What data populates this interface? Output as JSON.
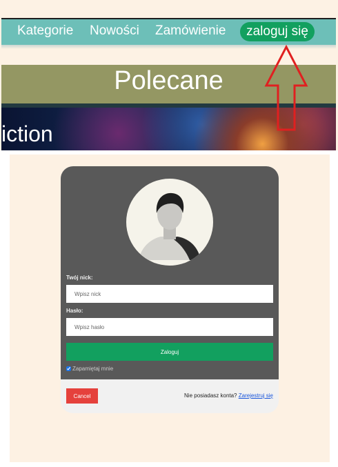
{
  "nav": {
    "items": [
      {
        "label": "Kategorie"
      },
      {
        "label": "Nowości"
      },
      {
        "label": "Zamówienie"
      }
    ],
    "login_label": "zaloguj się"
  },
  "featured": {
    "title": "Polecane"
  },
  "banner": {
    "title": "iction"
  },
  "login_form": {
    "nick_label": "Twój nick:",
    "nick_placeholder": "Wpisz nick",
    "password_label": "Hasło:",
    "password_placeholder": "Wpisz hasło",
    "submit_label": "Zaloguj",
    "remember_label": "Zapamiętaj mnie",
    "remember_checked": true
  },
  "footer": {
    "cancel_label": "Cancel",
    "no_account_text": "Nie posiadasz konta?",
    "register_link": "Zarejestruj się"
  },
  "colors": {
    "nav_bg": "#6dbfb8",
    "login_pill": "#12a05f",
    "featured_bar": "#949763",
    "modal_dark": "#595959",
    "submit_button": "#12a05f",
    "cancel_button": "#e5413c",
    "page_bg": "#fdf1e3",
    "arrow": "#e02020"
  },
  "icons": {
    "avatar": "user-silhouette-icon",
    "annotation": "red-arrow-up-icon"
  }
}
